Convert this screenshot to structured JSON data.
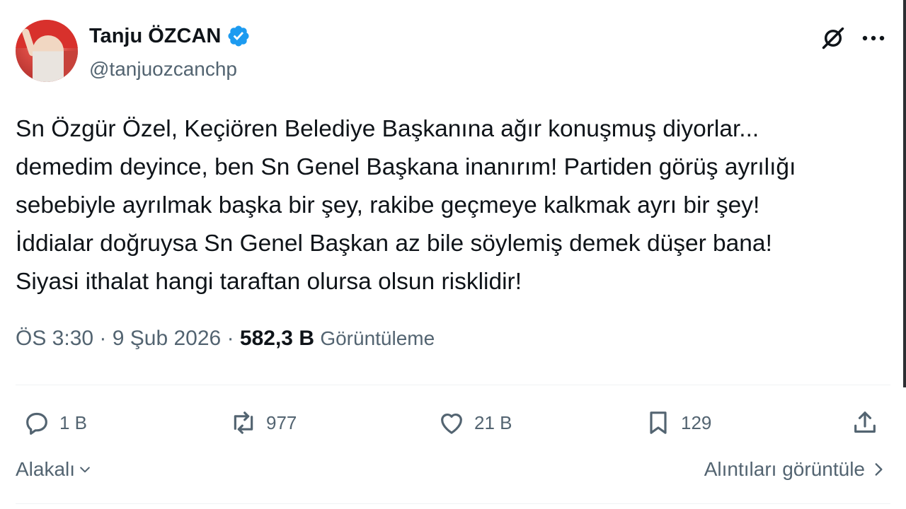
{
  "author": {
    "name": "Tanju ÖZCAN",
    "handle": "@tanjuozcanchp",
    "verified": true,
    "verified_color": "#1d9bf0"
  },
  "header_icons": {
    "grok": "grok-icon",
    "more": "more-icon"
  },
  "tweet": {
    "lines": [
      "Sn Özgür Özel, Keçiören Belediye Başkanına ağır konuşmuş diyorlar...",
      "demedim deyince, ben Sn Genel Başkana inanırım! Partiden görüş ayrılığı",
      "sebebiyle ayrılmak başka bir şey, rakibe geçmeye kalkmak ayrı bir şey!",
      "İddialar doğruysa Sn Genel Başkan az bile söylemiş demek düşer bana!",
      "Siyasi ithalat hangi taraftan olursa olsun risklidir!"
    ]
  },
  "meta": {
    "time": "ÖS 3:30",
    "date": "9 Şub 2026",
    "views_count": "582,3 B",
    "views_label": "Görüntüleme"
  },
  "actions": {
    "replies": "1 B",
    "reposts": "977",
    "likes": "21 B",
    "bookmarks": "129"
  },
  "footer": {
    "related_label": "Alakalı",
    "quotes_label": "Alıntıları görüntüle"
  }
}
